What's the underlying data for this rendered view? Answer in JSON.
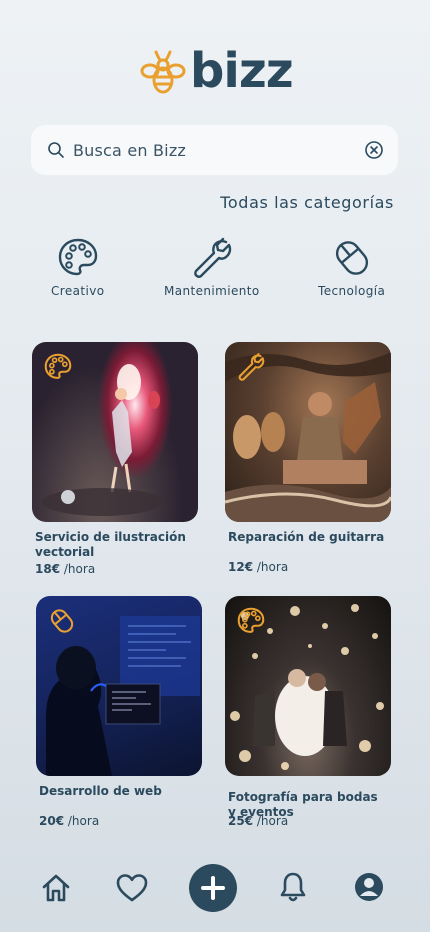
{
  "app": {
    "logo_text": "bizz"
  },
  "search": {
    "placeholder": "Busca en Bizz"
  },
  "categories": {
    "all_label": "Todas las categorías",
    "items": [
      {
        "label": "Creativo",
        "icon": "palette-icon"
      },
      {
        "label": "Mantenimiento",
        "icon": "wrench-icon"
      },
      {
        "label": "Tecnología",
        "icon": "mouse-icon"
      }
    ]
  },
  "listings": [
    {
      "title": "Servicio de ilustración vectorial",
      "price": "18€",
      "unit": "/hora",
      "icon": "palette-icon"
    },
    {
      "title": "Reparación de guitarra",
      "price": "12€",
      "unit": "/hora",
      "icon": "wrench-icon"
    },
    {
      "title": "Desarrollo de web",
      "price": "20€",
      "unit": "/hora",
      "icon": "mouse-icon"
    },
    {
      "title": "Fotografía para bodas y eventos",
      "price": "25€",
      "unit": "/hora",
      "icon": "palette-icon"
    }
  ],
  "nav": [
    "home-icon",
    "heart-icon",
    "plus-icon",
    "bell-icon",
    "profile-icon"
  ],
  "colors": {
    "primary": "#2b4a5e",
    "accent": "#e9a030",
    "background": "#e3e9ee"
  }
}
